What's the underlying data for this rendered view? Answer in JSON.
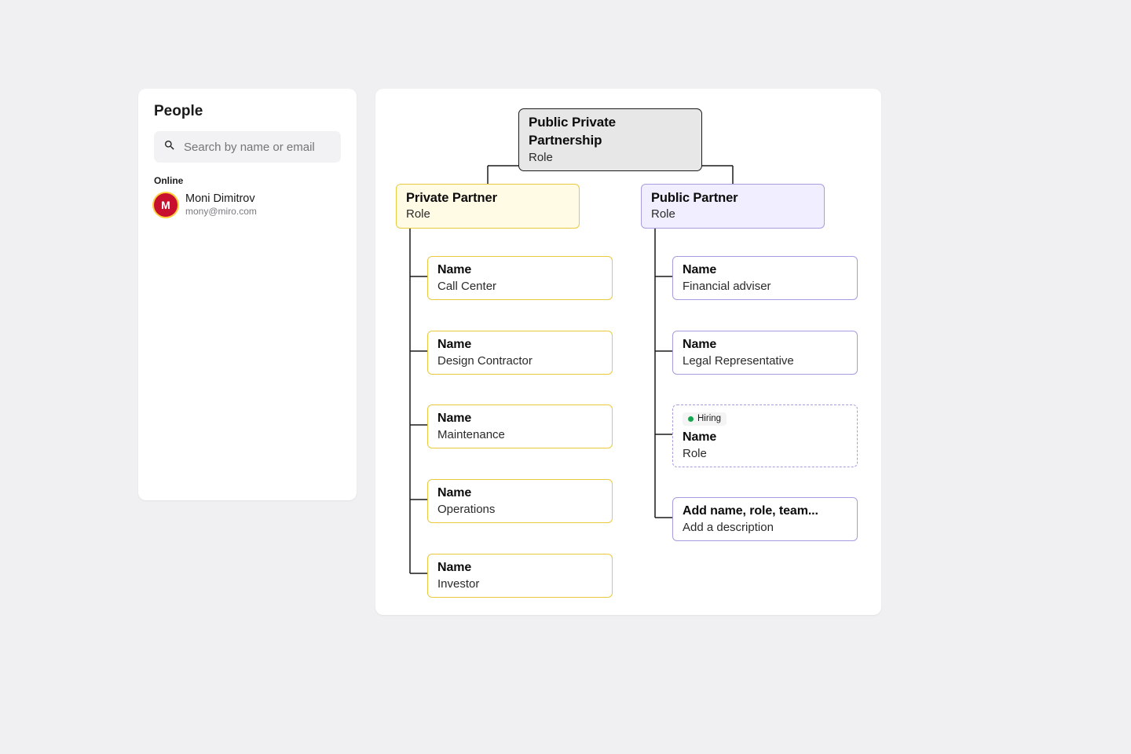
{
  "people": {
    "title": "People",
    "search_placeholder": "Search by name or email",
    "section_online": "Online",
    "user": {
      "initial": "M",
      "name": "Moni Dimitrov",
      "email": "mony@miro.com"
    }
  },
  "org": {
    "root": {
      "title": "Public Private Partnership",
      "subtitle": "Role"
    },
    "private": {
      "title": "Private Partner",
      "subtitle": "Role"
    },
    "public": {
      "title": "Public Partner",
      "subtitle": "Role"
    },
    "private_children": [
      {
        "title": "Name",
        "subtitle": "Call Center"
      },
      {
        "title": "Name",
        "subtitle": "Design Contractor"
      },
      {
        "title": "Name",
        "subtitle": "Maintenance"
      },
      {
        "title": "Name",
        "subtitle": "Operations"
      },
      {
        "title": "Name",
        "subtitle": "Investor"
      }
    ],
    "public_children": [
      {
        "title": "Name",
        "subtitle": "Financial adviser"
      },
      {
        "title": "Name",
        "subtitle": "Legal Representative"
      },
      {
        "title": "Name",
        "subtitle": "Role",
        "badge": "Hiring"
      },
      {
        "title": "Add name, role, team...",
        "subtitle": "Add a description"
      }
    ]
  }
}
